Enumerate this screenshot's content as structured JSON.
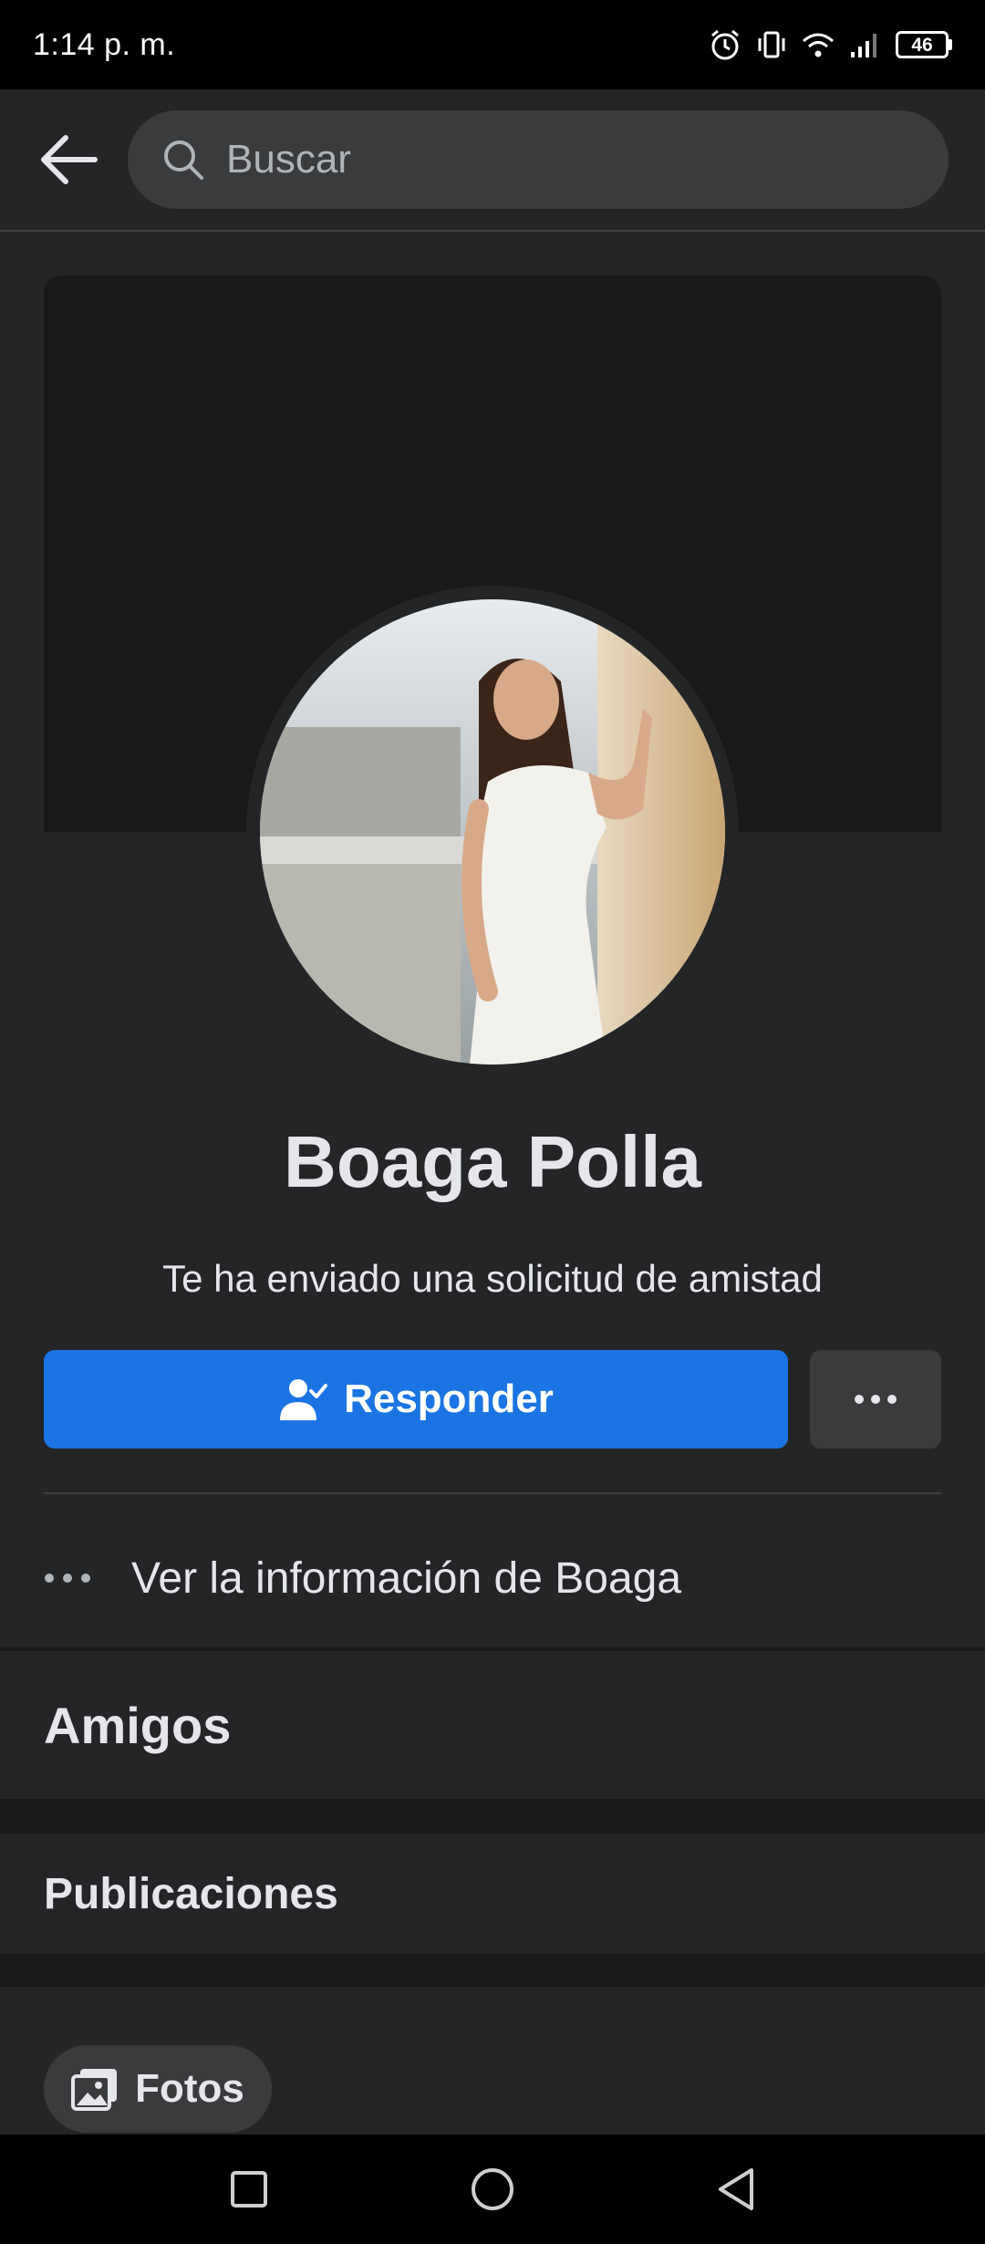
{
  "status_bar": {
    "time": "1:14 p. m.",
    "battery": "46",
    "icons": [
      "alarm-icon",
      "vibrate-icon",
      "wifi-icon",
      "signal-icon",
      "battery-icon"
    ]
  },
  "header": {
    "back_icon": "arrow-left-icon",
    "search": {
      "placeholder": "Buscar",
      "icon": "search-icon"
    }
  },
  "profile": {
    "name": "Boaga Polla",
    "request_text": "Te ha enviado una solicitud de amistad",
    "respond_button": {
      "label": "Responder",
      "icon": "user-check-icon"
    },
    "more_icon": "more-horizontal-icon",
    "info_link": "Ver la información de Boaga"
  },
  "sections": {
    "friends": "Amigos",
    "posts": "Publicaciones",
    "photos_chip": "Fotos"
  },
  "nav_bar": {
    "buttons": [
      "recent-apps-icon",
      "home-icon",
      "back-triangle-icon"
    ]
  },
  "colors": {
    "background": "#242526",
    "cover": "#18191a",
    "primary_button": "#1b74e4",
    "secondary_button": "#3a3b3c",
    "text": "#e4e6eb"
  }
}
